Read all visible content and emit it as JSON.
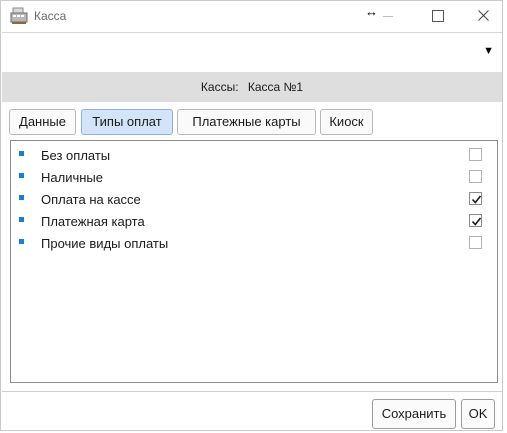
{
  "window": {
    "title": "Касса",
    "controls": [
      "minimize-icon",
      "maximize-icon",
      "close-icon"
    ]
  },
  "dropdown": {
    "value": "",
    "arrow": "▼"
  },
  "header": {
    "label": "Кассы:",
    "value": "Касса №1"
  },
  "tabs": [
    {
      "label": "Данные",
      "active": false
    },
    {
      "label": "Типы оплат",
      "active": true
    },
    {
      "label": "Платежные карты",
      "active": false
    },
    {
      "label": "Киоск",
      "active": false
    }
  ],
  "payment_types": [
    {
      "label": "Без оплаты",
      "checked": false
    },
    {
      "label": "Наличные",
      "checked": false
    },
    {
      "label": "Оплата на кассе",
      "checked": true
    },
    {
      "label": "Платежная карта",
      "checked": true
    },
    {
      "label": "Прочие виды оплаты",
      "checked": false
    }
  ],
  "buttons": {
    "save": "Сохранить",
    "ok": "OK"
  },
  "colors": {
    "bullet": "#1b7fd0",
    "active_tab": "#d3e4f8",
    "header_band": "#dedede"
  }
}
